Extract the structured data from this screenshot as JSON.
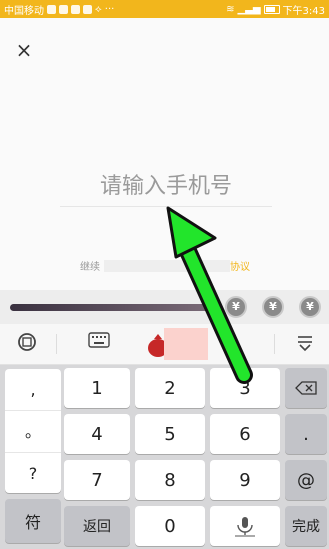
{
  "statusbar": {
    "carrier": "中国移动",
    "time": "下午3:43"
  },
  "close_icon": "×",
  "phone": {
    "placeholder": "请输入手机号"
  },
  "agreement": {
    "prefix": "继续",
    "link": "协议"
  },
  "currency_symbol": "¥",
  "keyboard": {
    "punctuation": [
      ",",
      "。",
      "?"
    ],
    "digits": [
      "1",
      "2",
      "3",
      "4",
      "5",
      "6",
      "7",
      "8",
      "9",
      "0"
    ],
    "dot": ".",
    "at": "@",
    "symbols": "符",
    "back": "返回",
    "done": "完成"
  },
  "colors": {
    "accent": "#f2b61c",
    "arrow": "#22e52b"
  }
}
